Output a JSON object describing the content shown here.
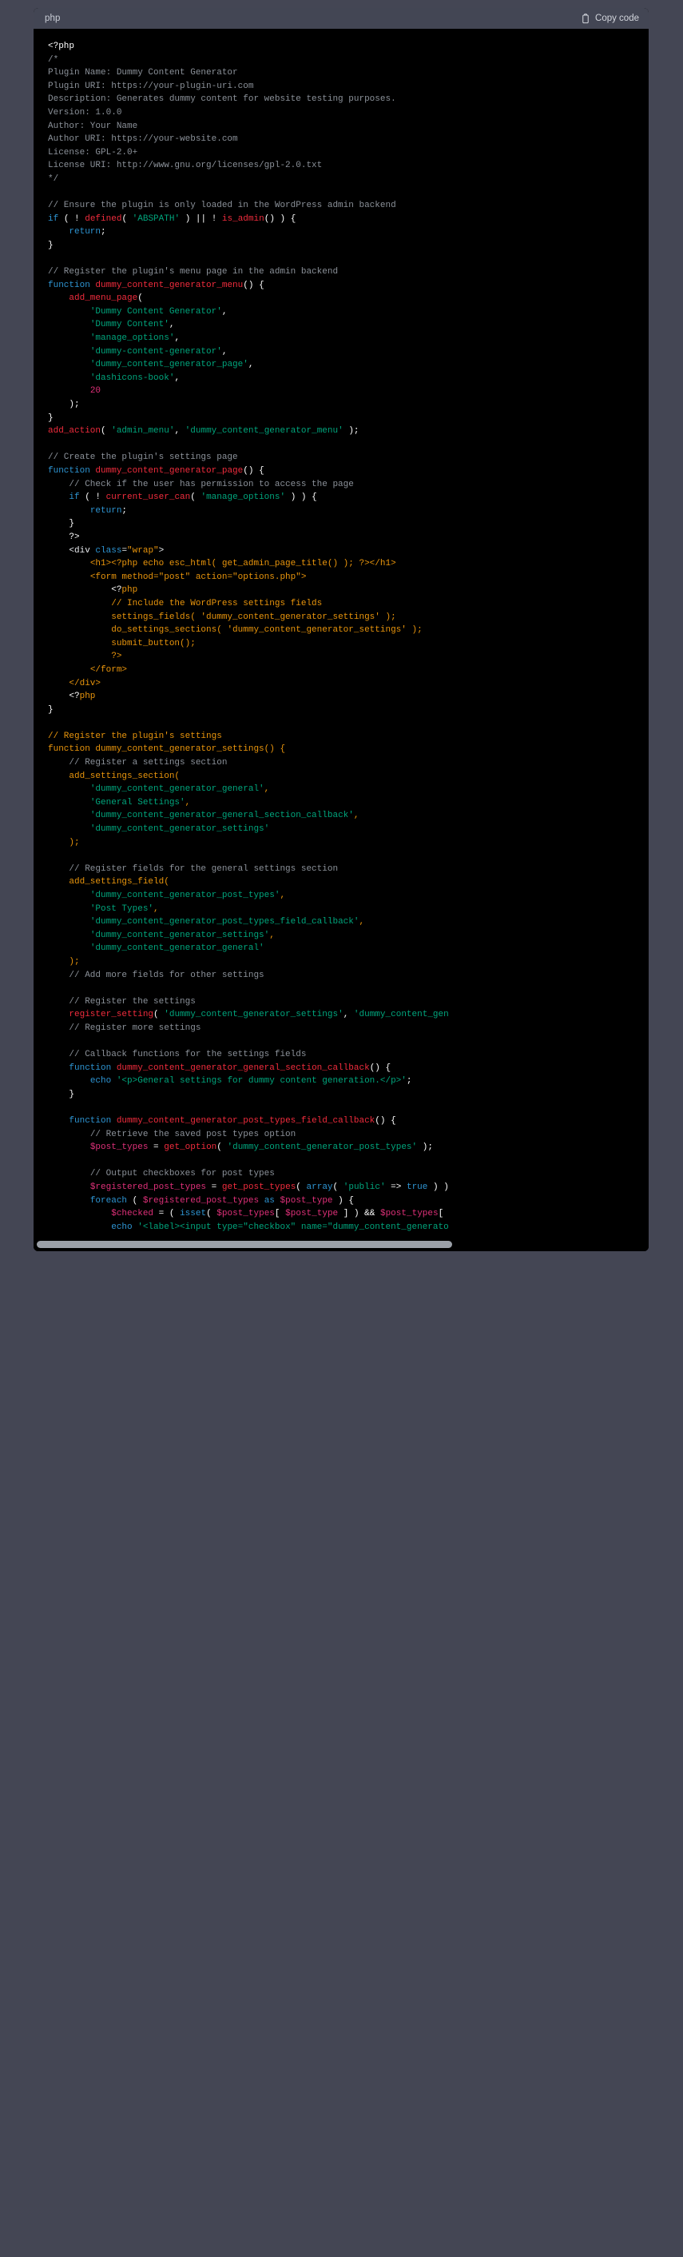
{
  "codeblock": {
    "language_label": "php",
    "copy_label": "Copy code",
    "copy_icon": "clipboard-icon",
    "theme": {
      "header_bg": "#434654",
      "code_bg": "#000000",
      "page_bg": "#444654",
      "comment": "#8b9199",
      "keyword": "#2e95d3",
      "function": "#f22c3d",
      "string": "#00a67d",
      "variable": "#df3079",
      "operator": "#ffffff",
      "plain": "#b9bcc4",
      "html_attr_value": "#e9950c",
      "orange_block": "#e9950c"
    },
    "scrollbar": {
      "orientation": "horizontal",
      "thumb_color": "#9ba0a8"
    }
  },
  "code": {
    "filetype": "php",
    "lines": [
      "<?php",
      "/*",
      "Plugin Name: Dummy Content Generator",
      "Plugin URI: https://your-plugin-uri.com",
      "Description: Generates dummy content for website testing purposes.",
      "Version: 1.0.0",
      "Author: Your Name",
      "Author URI: https://your-website.com",
      "License: GPL-2.0+",
      "License URI: http://www.gnu.org/licenses/gpl-2.0.txt",
      "*/",
      "",
      "// Ensure the plugin is only loaded in the WordPress admin backend",
      "if ( ! defined( 'ABSPATH' ) || ! is_admin() ) {",
      "    return;",
      "}",
      "",
      "// Register the plugin's menu page in the admin backend",
      "function dummy_content_generator_menu() {",
      "    add_menu_page(",
      "        'Dummy Content Generator',",
      "        'Dummy Content',",
      "        'manage_options',",
      "        'dummy-content-generator',",
      "        'dummy_content_generator_page',",
      "        'dashicons-book',",
      "        20",
      "    );",
      "}",
      "add_action( 'admin_menu', 'dummy_content_generator_menu' );",
      "",
      "// Create the plugin's settings page",
      "function dummy_content_generator_page() {",
      "    // Check if the user has permission to access the page",
      "    if ( ! current_user_can( 'manage_options' ) ) {",
      "        return;",
      "    }",
      "    ?>",
      "    <div class=\"wrap\">",
      "        <h1><?php echo esc_html( get_admin_page_title() ); ?></h1>",
      "        <form method=\"post\" action=\"options.php\">",
      "            <?php",
      "            // Include the WordPress settings fields",
      "            settings_fields( 'dummy_content_generator_settings' );",
      "            do_settings_sections( 'dummy_content_generator_settings' );",
      "            submit_button();",
      "            ?>",
      "        </form>",
      "    </div>",
      "    <?php",
      "}",
      "",
      "// Register the plugin's settings",
      "function dummy_content_generator_settings() {",
      "    // Register a settings section",
      "    add_settings_section(",
      "        'dummy_content_generator_general',",
      "        'General Settings',",
      "        'dummy_content_generator_general_section_callback',",
      "        'dummy_content_generator_settings'",
      "    );",
      "",
      "    // Register fields for the general settings section",
      "    add_settings_field(",
      "        'dummy_content_generator_post_types',",
      "        'Post Types',",
      "        'dummy_content_generator_post_types_field_callback',",
      "        'dummy_content_generator_settings',",
      "        'dummy_content_generator_general'",
      "    );",
      "    // Add more fields for other settings",
      "",
      "    // Register the settings",
      "    register_setting( 'dummy_content_generator_settings', 'dummy_content_gen",
      "    // Register more settings",
      "",
      "    // Callback functions for the settings fields",
      "    function dummy_content_generator_general_section_callback() {",
      "        echo '<p>General settings for dummy content generation.</p>';",
      "    }",
      "",
      "    function dummy_content_generator_post_types_field_callback() {",
      "        // Retrieve the saved post types option",
      "        $post_types = get_option( 'dummy_content_generator_post_types' );",
      "",
      "        // Output checkboxes for post types",
      "        $registered_post_types = get_post_types( array( 'public' => true ) )",
      "        foreach ( $registered_post_types as $post_type ) {",
      "            $checked = ( isset( $post_types[ $post_type ] ) && $post_types[",
      "            echo '<label><input type=\"checkbox\" name=\"dummy_content_generato"
    ]
  }
}
